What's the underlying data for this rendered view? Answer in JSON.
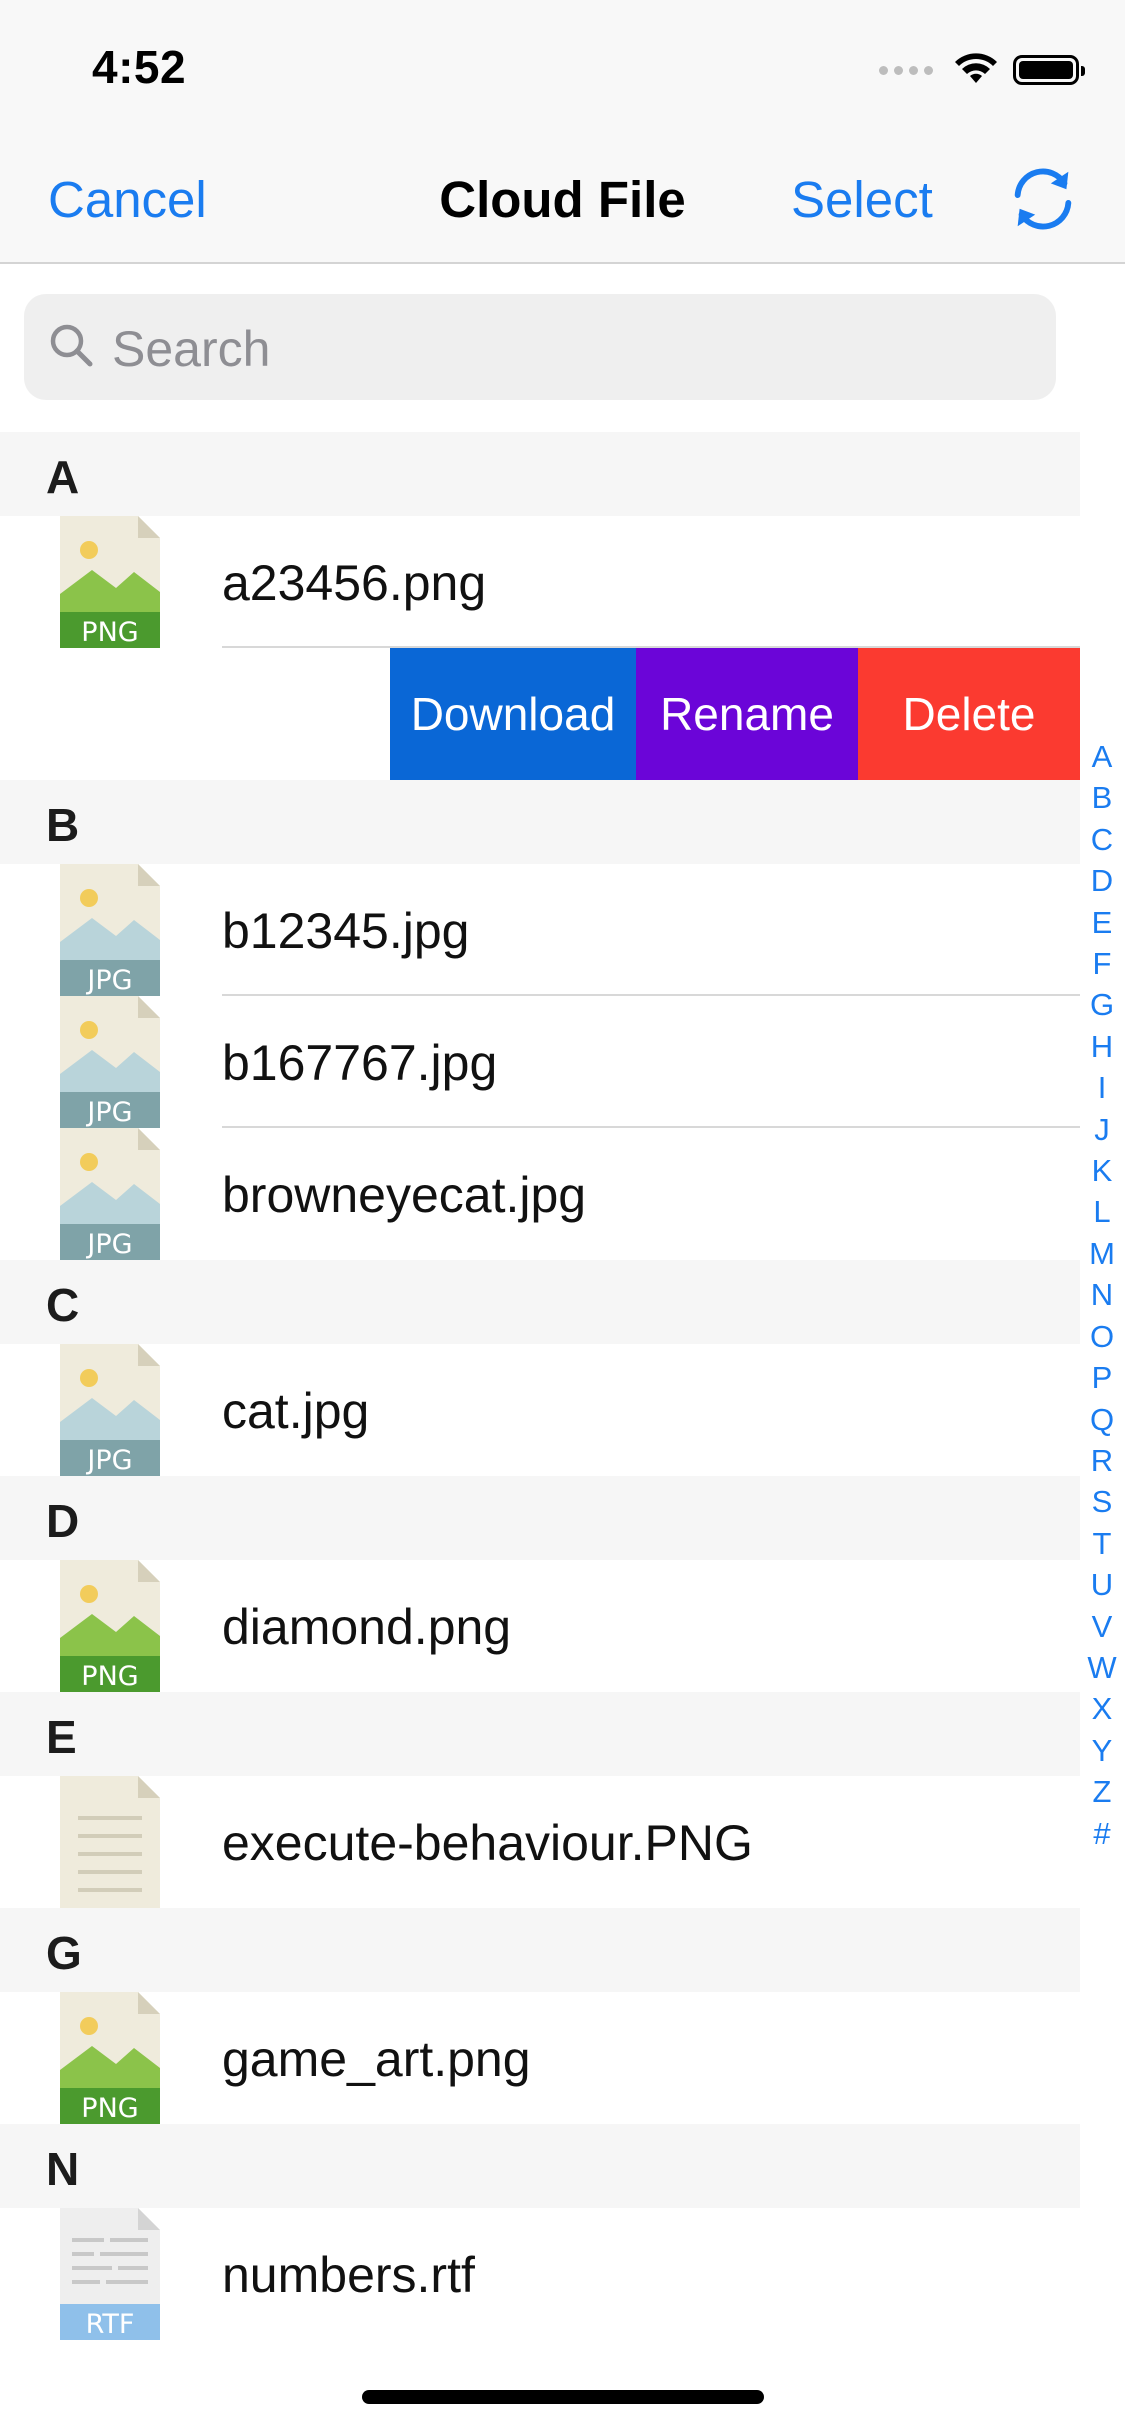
{
  "status": {
    "time": "4:52"
  },
  "nav": {
    "cancel": "Cancel",
    "title": "Cloud File",
    "select": "Select"
  },
  "search": {
    "placeholder": "Search"
  },
  "swipe_actions": {
    "download": "Download",
    "rename": "Rename",
    "delete": "Delete"
  },
  "sections": [
    {
      "letter": "A",
      "files": [
        {
          "name": "a23456.png",
          "icon": "png-file-icon"
        }
      ]
    },
    {
      "letter": "B",
      "files": [
        {
          "name": "b12345.jpg",
          "icon": "jpg-file-icon"
        },
        {
          "name": "b167767.jpg",
          "icon": "jpg-file-icon"
        },
        {
          "name": "browneyecat.jpg",
          "icon": "jpg-file-icon"
        }
      ]
    },
    {
      "letter": "C",
      "files": [
        {
          "name": "cat.jpg",
          "icon": "jpg-file-icon"
        }
      ]
    },
    {
      "letter": "D",
      "files": [
        {
          "name": "diamond.png",
          "icon": "png-file-icon"
        }
      ]
    },
    {
      "letter": "E",
      "files": [
        {
          "name": "execute-behaviour.PNG",
          "icon": "document-file-icon"
        }
      ]
    },
    {
      "letter": "G",
      "files": [
        {
          "name": "game_art.png",
          "icon": "png-file-icon"
        }
      ]
    },
    {
      "letter": "N",
      "files": [
        {
          "name": "numbers.rtf",
          "icon": "rtf-file-icon"
        }
      ]
    }
  ],
  "icon_labels": {
    "png": "PNG",
    "jpg": "JPG",
    "rtf": "RTF"
  },
  "index_letters": [
    "A",
    "B",
    "C",
    "D",
    "E",
    "F",
    "G",
    "H",
    "I",
    "J",
    "K",
    "L",
    "M",
    "N",
    "O",
    "P",
    "Q",
    "R",
    "S",
    "T",
    "U",
    "V",
    "W",
    "X",
    "Y",
    "Z",
    "#"
  ],
  "colors": {
    "accent": "#1a7cf0",
    "download": "#0a67d6",
    "rename": "#6b05d8",
    "delete": "#fb3a30"
  }
}
